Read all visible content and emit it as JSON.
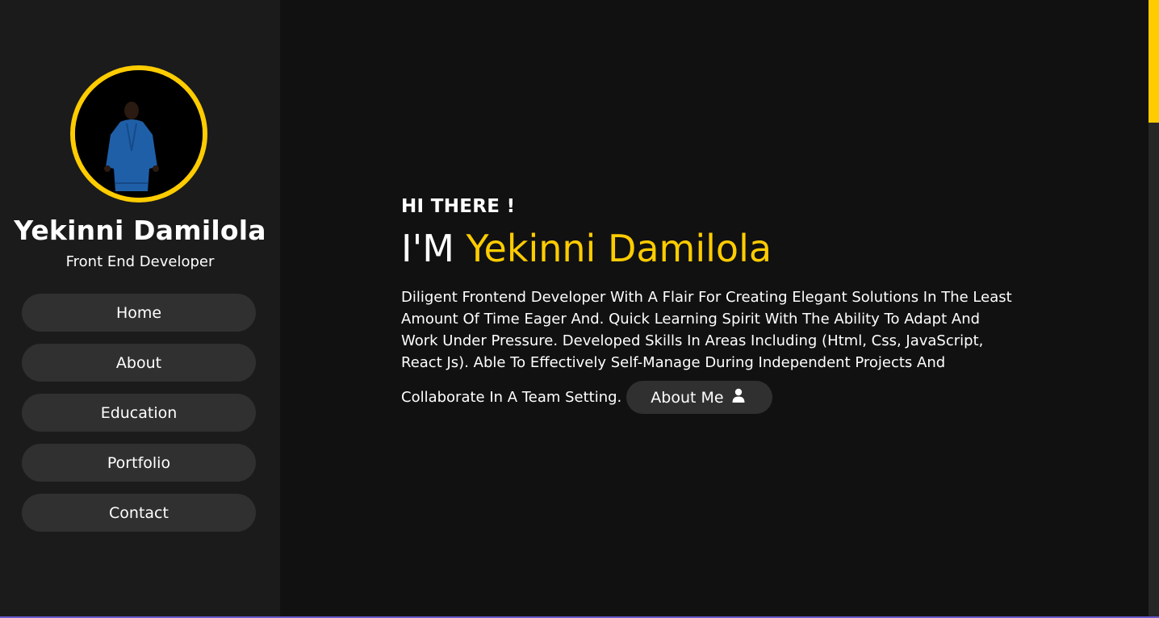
{
  "sidebar": {
    "profile_name": "Yekinni Damilola",
    "profile_role": "Front End Developer",
    "nav": [
      {
        "label": "Home"
      },
      {
        "label": "About"
      },
      {
        "label": "Education"
      },
      {
        "label": "Portfolio"
      },
      {
        "label": "Contact"
      }
    ]
  },
  "hero": {
    "greeting": "HI THERE !",
    "headline_prefix": "I'M",
    "headline_name": "Yekinni Damilola",
    "bio_lines": [
      "Diligent Frontend Developer With A Flair For Creating Elegant Solutions In The Least",
      "Amount Of Time Eager And. Quick Learning Spirit With The Ability To Adapt And",
      "Work Under Pressure. Developed Skills In Areas Including (Html, Css, JavaScript,",
      "React Js). Able To Effectively Self-Manage During Independent Projects And"
    ],
    "bio_last": "Collaborate In A Team Setting.",
    "about_button": "About Me",
    "about_icon": "user-icon"
  },
  "theme": {
    "accent": "#ffcc00",
    "background": "#111111",
    "sidebar_bg": "#1b1b1b",
    "button_bg": "#303030"
  }
}
